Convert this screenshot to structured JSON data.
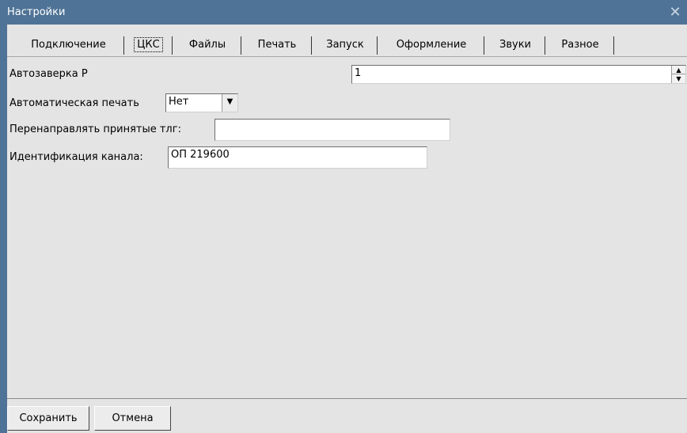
{
  "window": {
    "title": "Настройки",
    "close_glyph": "✕"
  },
  "tabs": [
    {
      "label": "Подключение",
      "active": false
    },
    {
      "label": "ЦКС",
      "active": true
    },
    {
      "label": "Файлы",
      "active": false
    },
    {
      "label": "Печать",
      "active": false
    },
    {
      "label": "Запуск",
      "active": false
    },
    {
      "label": "Оформление",
      "active": false
    },
    {
      "label": "Звуки",
      "active": false
    },
    {
      "label": "Разное",
      "active": false
    }
  ],
  "form": {
    "autozaverka": {
      "label": "Автозаверка Р",
      "value": "1"
    },
    "autoprint": {
      "label": "Автоматическая печать",
      "value": "Нет"
    },
    "redirect": {
      "label": "Перенаправлять принятые тлг:",
      "value": ""
    },
    "channel_id": {
      "label": "Идентификация канала:",
      "value": "ОП 219600"
    }
  },
  "buttons": {
    "save": "Сохранить",
    "cancel": "Отмена"
  },
  "icons": {
    "close": "close-icon",
    "spin_up": "arrow-up-icon",
    "spin_down": "arrow-down-icon",
    "dropdown": "chevron-down-icon"
  },
  "colors": {
    "titlebar": "#4f7396",
    "client_bg": "#e4e4e4"
  }
}
